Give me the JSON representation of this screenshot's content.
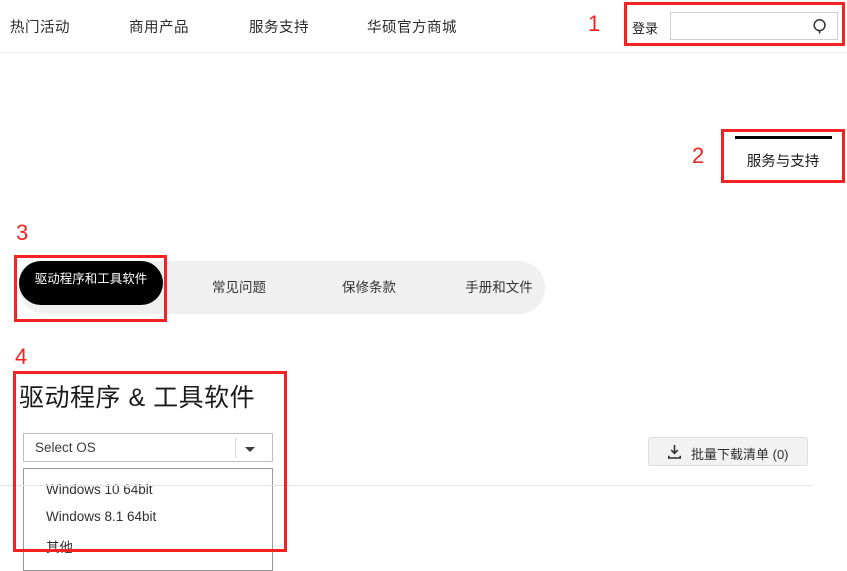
{
  "header": {
    "nav_items": [
      {
        "label": "热门活动"
      },
      {
        "label": "商用产品"
      },
      {
        "label": "服务支持"
      },
      {
        "label": "华硕官方商城"
      }
    ],
    "login_label": "登录",
    "search": {
      "value": "",
      "placeholder": "",
      "icon": "search-icon"
    }
  },
  "service_support": {
    "label": "服务与支持"
  },
  "tabs": [
    {
      "label": "驱动程序和工具软件",
      "active": true
    },
    {
      "label": "常见问题",
      "active": false
    },
    {
      "label": "保修条款",
      "active": false
    },
    {
      "label": "手册和文件",
      "active": false
    }
  ],
  "drivers": {
    "heading": "驱动程序 & 工具软件",
    "os_select": {
      "value": "Select OS",
      "arrow_icon": "chevron-down-icon",
      "options": [
        {
          "label": "Windows 10 64bit"
        },
        {
          "label": "Windows 8.1 64bit"
        },
        {
          "label": "其他"
        }
      ]
    },
    "bulk_download": {
      "label": "批量下载清单 (0)",
      "icon": "download-icon"
    }
  },
  "annotations": [
    {
      "number": "1"
    },
    {
      "number": "2"
    },
    {
      "number": "3"
    },
    {
      "number": "4"
    }
  ],
  "colors": {
    "annotation_red": "#f42222",
    "active_tab_bg": "#000000",
    "tabbar_bg": "#f0f0f0",
    "text": "#222222"
  }
}
